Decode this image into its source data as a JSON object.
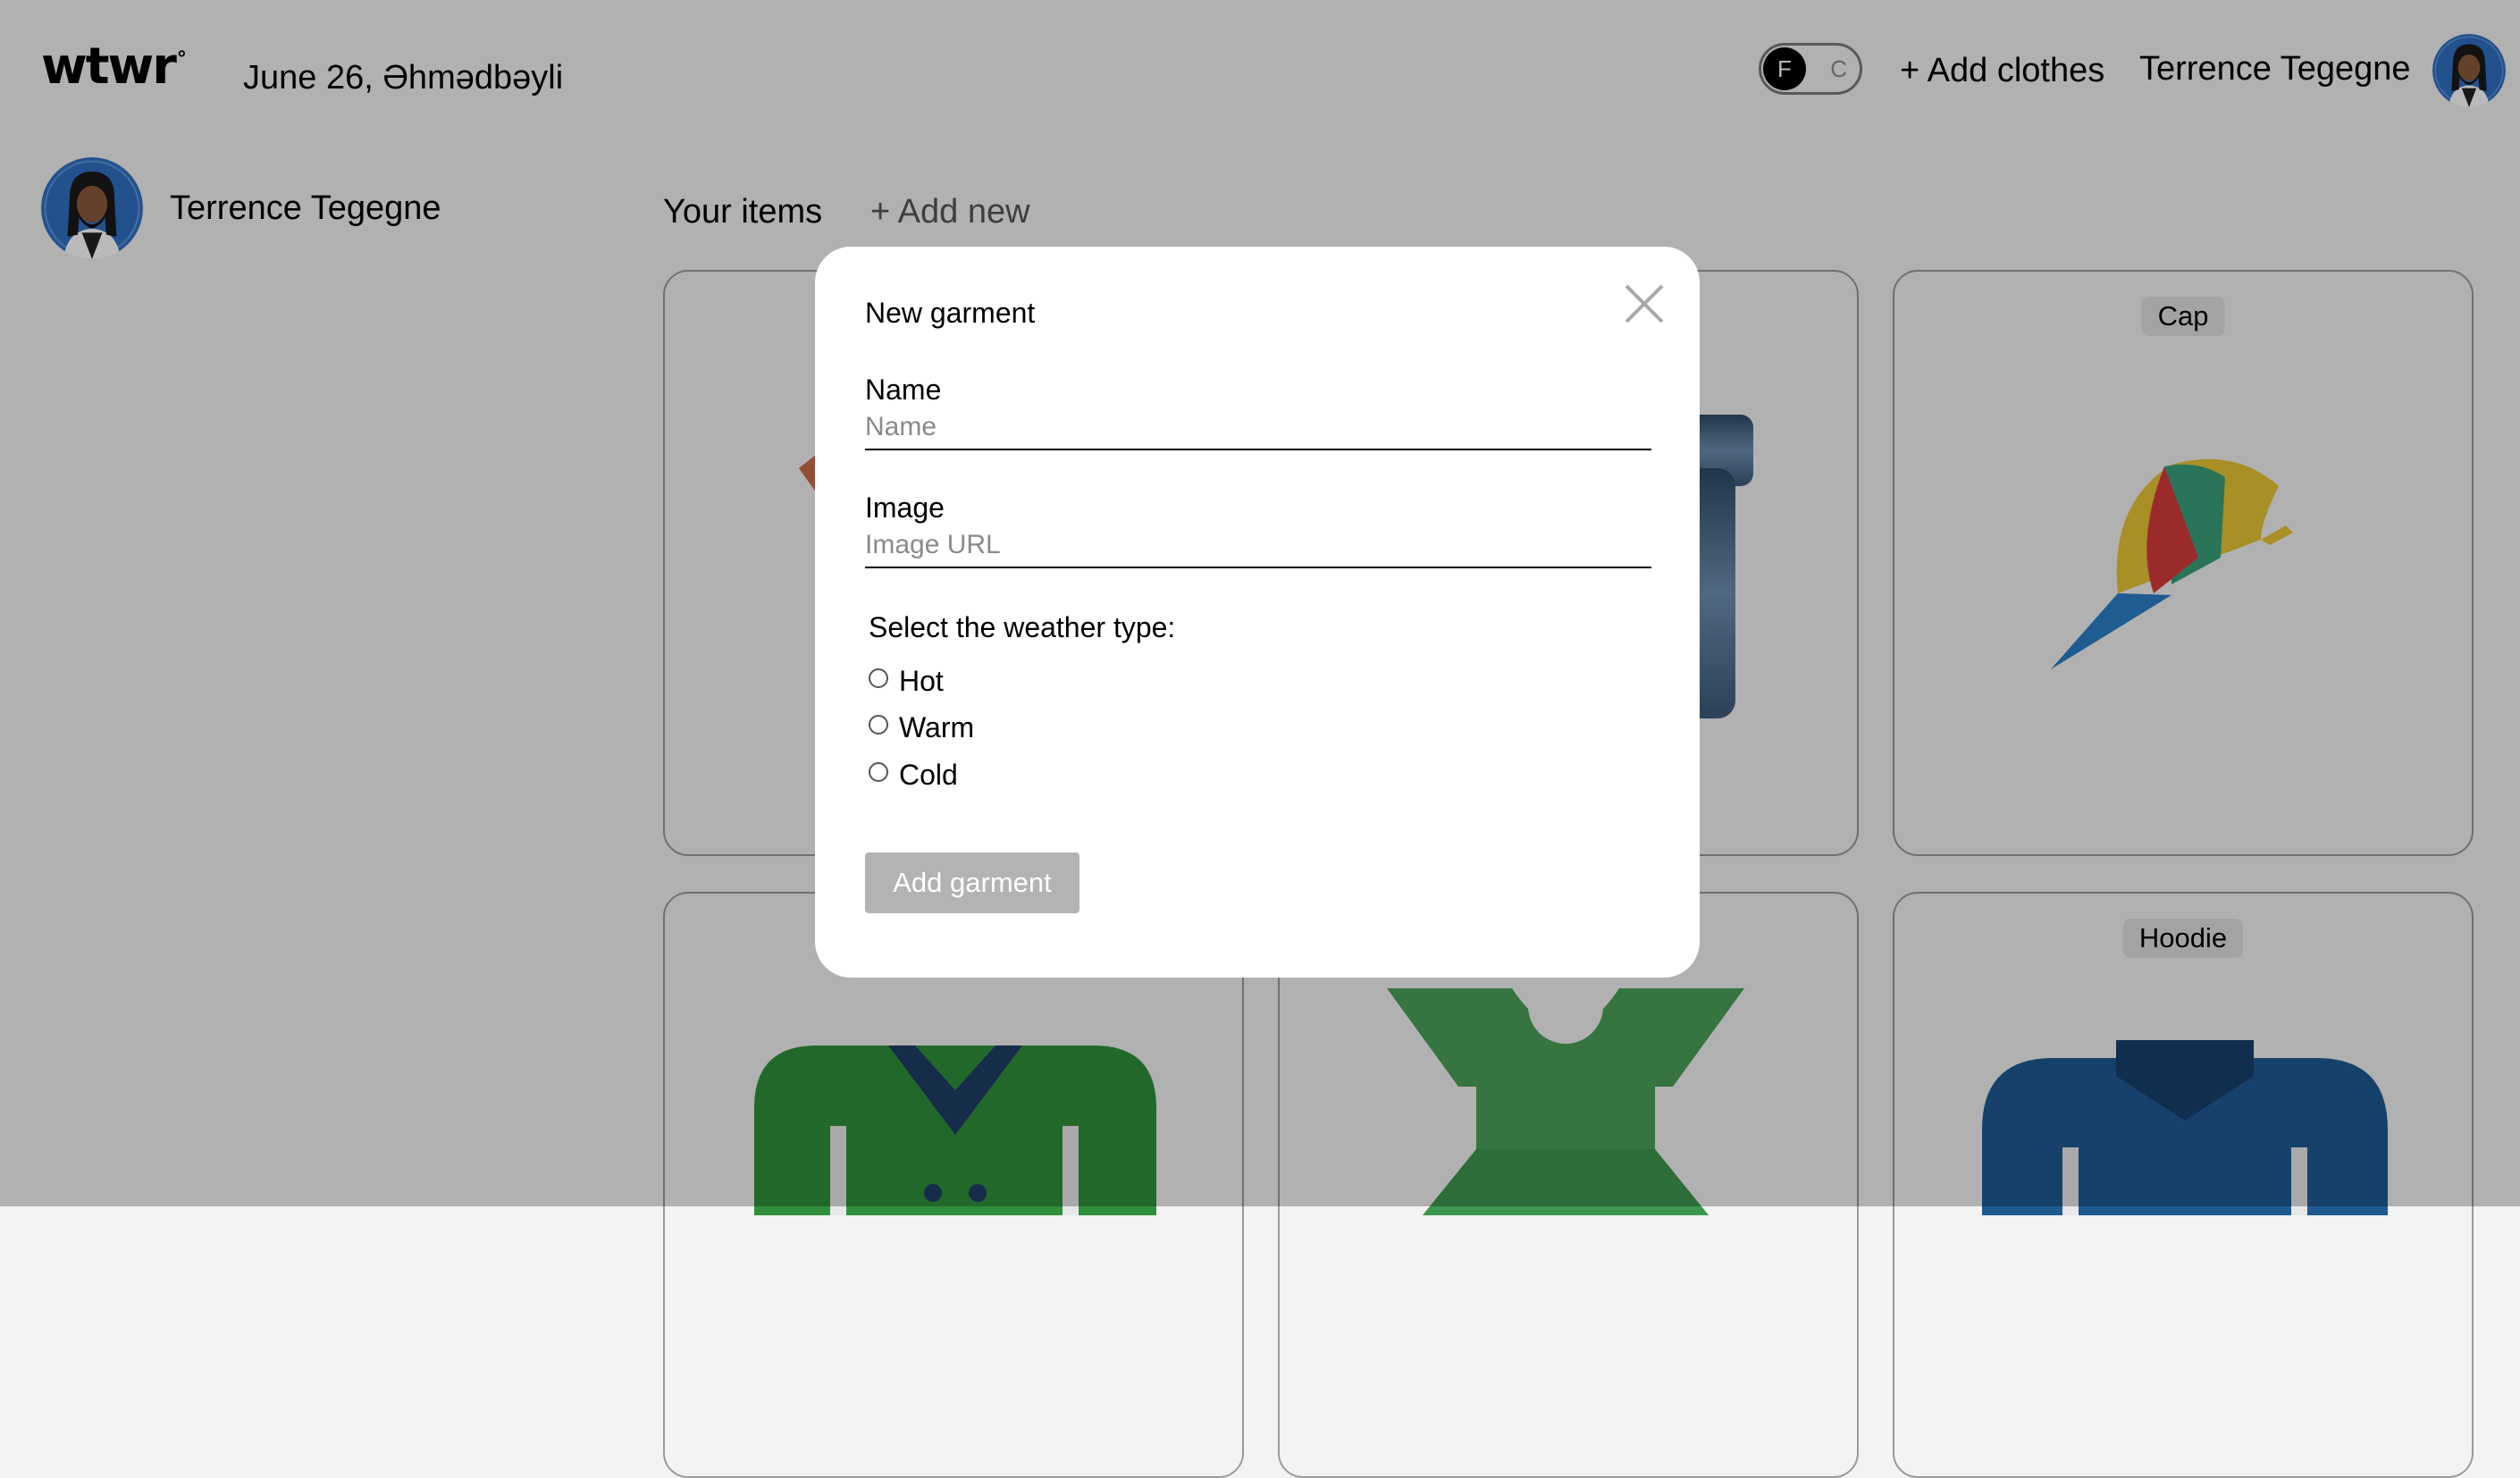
{
  "header": {
    "logo": "wtwr",
    "logo_mark": "°",
    "date_location": "June 26, Əhmədbəyli",
    "toggle": {
      "selected": "F",
      "other": "C"
    },
    "add_clothes": "+ Add clothes",
    "username": "Terrence Tegegne"
  },
  "sidebar": {
    "username": "Terrence Tegegne"
  },
  "main": {
    "section_title": "Your items",
    "add_new": "+ Add new",
    "cards": [
      {
        "label": "",
        "icon": "t-shirt-icon"
      },
      {
        "label": "",
        "icon": "jeans-icon"
      },
      {
        "label": "Cap",
        "icon": "cap-icon"
      },
      {
        "label": "",
        "icon": "coat-icon"
      },
      {
        "label": "",
        "icon": "dress-icon"
      },
      {
        "label": "Hoodie",
        "icon": "hoodie-icon"
      }
    ]
  },
  "modal": {
    "title": "New garment",
    "name_label": "Name",
    "name_placeholder": "Name",
    "image_label": "Image",
    "image_placeholder": "Image URL",
    "weather_legend": "Select the weather type:",
    "options": [
      "Hot",
      "Warm",
      "Cold"
    ],
    "submit": "Add garment"
  }
}
